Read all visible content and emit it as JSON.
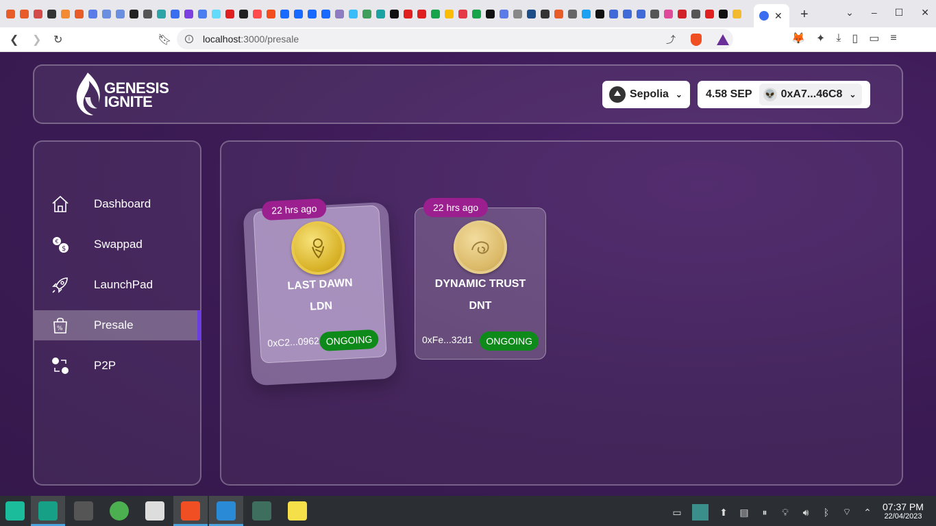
{
  "browser": {
    "tab_favicon_colors": [
      "#e85c2a",
      "#e85c2a",
      "#d34b4b",
      "#333333",
      "#f28b33",
      "#e85c2a",
      "#5b7ce8",
      "#6a8fe0",
      "#6a8fe0",
      "#222222",
      "#555555",
      "#2ea3a8",
      "#3b6df0",
      "#7c3fe0",
      "#4a7ef0",
      "#61dafb",
      "#e02020",
      "#222222",
      "#ff4b4b",
      "#f24e1e",
      "#1769ff",
      "#1769ff",
      "#1769ff",
      "#1769ff",
      "#8e7cc3",
      "#38bdf8",
      "#3f9e5a",
      "#1aa3a3",
      "#111111",
      "#e02020",
      "#e02020",
      "#16a34a",
      "#fbbc04",
      "#e63946",
      "#16a34a",
      "#111111",
      "#5b7ce8",
      "#888888",
      "#1d4e89",
      "#333333",
      "#e85c2a",
      "#666666",
      "#1da1f2",
      "#111111",
      "#3f6ad8",
      "#3f6ad8",
      "#3f6ad8",
      "#555555",
      "#e04a9a",
      "#d22128",
      "#555555",
      "#e02020",
      "#111111",
      "#f3ba2f"
    ],
    "active_tab_close": "✕",
    "new_tab": "+",
    "url_host": "localhost",
    "url_path": ":3000/presale"
  },
  "app": {
    "logo_line1": "GENESIS",
    "logo_line2": "IGNITE",
    "network_label": "Sepolia",
    "balance": "4.58 SEP",
    "account_address": "0xA7...46C8"
  },
  "sidebar": {
    "items": [
      {
        "label": "Dashboard",
        "icon": "home-icon"
      },
      {
        "label": "Swappad",
        "icon": "coins-swap-icon"
      },
      {
        "label": "LaunchPad",
        "icon": "rocket-icon"
      },
      {
        "label": "Presale",
        "icon": "shopping-bag-percent-icon",
        "active": true
      },
      {
        "label": "P2P",
        "icon": "p2p-exchange-icon"
      }
    ]
  },
  "presales": [
    {
      "age": "22 hrs ago",
      "name": "LAST DAWN",
      "symbol": "LDN",
      "address": "0xC2...0962",
      "status": "ONGOING"
    },
    {
      "age": "22 hrs ago",
      "name": "DYNAMIC TRUST",
      "symbol": "DNT",
      "address": "0xFe...32d1",
      "status": "ONGOING"
    }
  ],
  "taskbar": {
    "time": "07:37 PM",
    "date": "22/04/2023"
  },
  "colors": {
    "page_bg": "#3c1b55",
    "age_badge": "#9b1f8f",
    "status_ongoing": "#0e8a1a",
    "sidebar_active_accent": "#6a3ee0"
  }
}
